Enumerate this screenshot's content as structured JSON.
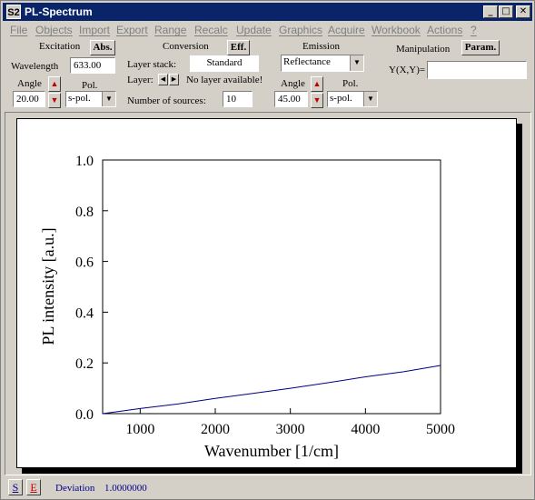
{
  "window": {
    "title": "PL-Spectrum",
    "icon_label": "S2",
    "controls": {
      "minimize": "_",
      "maximize": "□",
      "close": "✕"
    }
  },
  "menu": [
    "File",
    "Objects",
    "Import",
    "Export",
    "Range",
    "Recalc",
    "Update",
    "Graphics",
    "Acquire",
    "Workbook",
    "Actions",
    "?"
  ],
  "excitation": {
    "header": "Excitation",
    "abs_button": "Abs.",
    "wavelength_label": "Wavelength",
    "wavelength_value": "633.00",
    "angle_label": "Angle",
    "angle_value": "20.00",
    "pol_label": "Pol.",
    "pol_value": "s-pol."
  },
  "conversion": {
    "header": "Conversion",
    "eff_button": "Eff.",
    "layer_stack_label": "Layer stack:",
    "layer_stack_value": "Standard",
    "layer_label": "Layer:",
    "layer_status": "No layer available!",
    "sources_label": "Number of sources:",
    "sources_value": "10"
  },
  "emission": {
    "header": "Emission",
    "mode_value": "Reflectance",
    "angle_label": "Angle",
    "angle_value": "45.00",
    "pol_label": "Pol.",
    "pol_value": "s-pol."
  },
  "manipulation": {
    "header": "Manipulation",
    "param_button": "Param.",
    "formula_label": "Y(X,Y)=",
    "formula_value": ""
  },
  "chart_data": {
    "type": "line",
    "xlabel": "Wavenumber [1/cm]",
    "ylabel": "PL intensity [a.u.]",
    "xlim": [
      500,
      5000
    ],
    "ylim": [
      0,
      1
    ],
    "x_ticks": [
      1000,
      2000,
      3000,
      4000,
      5000
    ],
    "y_ticks": [
      "0.0",
      "0.2",
      "0.4",
      "0.6",
      "0.8",
      "1.0"
    ],
    "series": [
      {
        "color": "#000080",
        "x": [
          500,
          1000,
          1500,
          2000,
          2500,
          3000,
          3500,
          4000,
          4500,
          5000
        ],
        "y": [
          0.0,
          0.02,
          0.038,
          0.06,
          0.08,
          0.1,
          0.122,
          0.145,
          0.165,
          0.19
        ]
      }
    ]
  },
  "status": {
    "s_button": "S",
    "e_button": "E",
    "deviation_label": "Deviation",
    "deviation_value": "1.0000000"
  }
}
